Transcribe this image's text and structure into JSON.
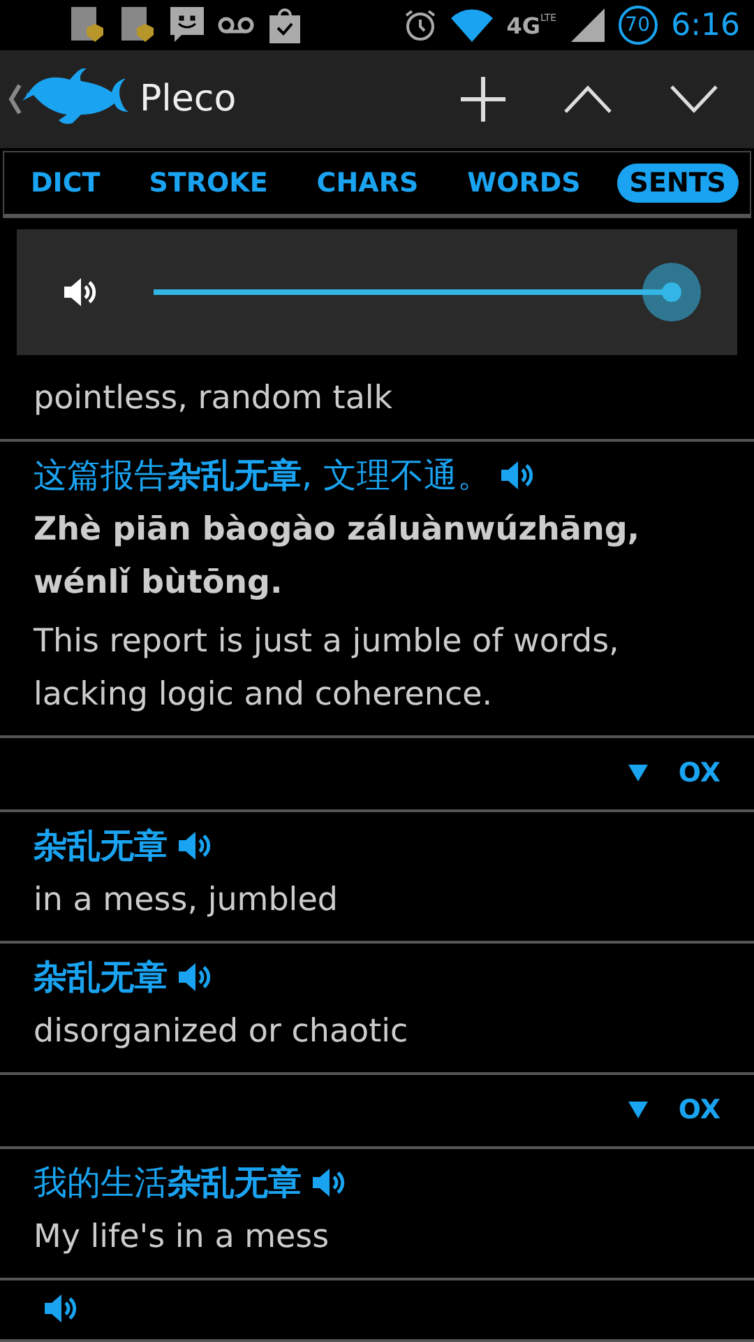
{
  "status_bar": {
    "network": "4G",
    "network_sub": "LTE",
    "battery": "70",
    "time": "6:16"
  },
  "action_bar": {
    "title": "Pleco"
  },
  "tabs": [
    {
      "label": "DICT",
      "selected": false
    },
    {
      "label": "STROKE",
      "selected": false
    },
    {
      "label": "CHARS",
      "selected": false
    },
    {
      "label": "WORDS",
      "selected": false
    },
    {
      "label": "SENTS",
      "selected": true
    }
  ],
  "volume": {
    "level": 1
  },
  "entries": [
    {
      "kind": "tail",
      "english": "pointless, random talk"
    },
    {
      "kind": "sentence",
      "chinese": "这篇报告**杂乱无章**, 文理不通。",
      "pinyin": "Zhè piān bàogào záluànwúzhāng, wénlǐ bùtōng.",
      "english": "This report is just a jumble of words, lacking logic and coherence."
    },
    {
      "kind": "source",
      "label": "OX"
    },
    {
      "kind": "word",
      "chinese": "杂乱无章",
      "english": "in a mess, jumbled"
    },
    {
      "kind": "word",
      "chinese": "杂乱无章",
      "english": "disorganized or chaotic"
    },
    {
      "kind": "source",
      "label": "OX"
    },
    {
      "kind": "sentence",
      "chinese": "我的生活**杂乱无章**",
      "english": "My life's in a mess"
    },
    {
      "kind": "audio"
    }
  ]
}
